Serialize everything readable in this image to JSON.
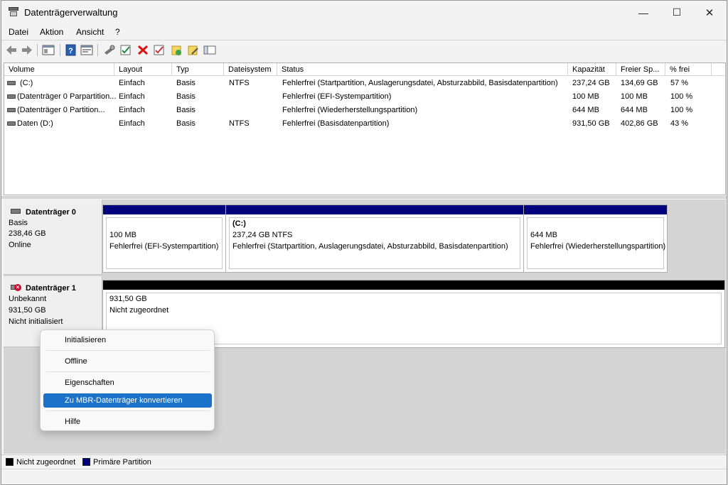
{
  "window": {
    "title": "Datenträgerverwaltung",
    "minimize": "—",
    "maximize": "☐",
    "close": "✕"
  },
  "menu": {
    "file": "Datei",
    "action": "Aktion",
    "view": "Ansicht",
    "help": "?"
  },
  "toolbar": [
    "back-icon",
    "forward-icon",
    "console-icon",
    "help-icon",
    "properties-icon",
    "connect-icon",
    "check-icon",
    "delete-icon",
    "check2-icon",
    "folder-add-icon",
    "folder-open-icon",
    "view-icon"
  ],
  "volumes": {
    "columns": [
      "Volume",
      "Layout",
      "Typ",
      "Dateisystem",
      "Status",
      "Kapazität",
      "Freier Sp...",
      "% frei"
    ],
    "rows": [
      [
        "(C:)",
        "Einfach",
        "Basis",
        "NTFS",
        "Fehlerfrei (Startpartition, Auslagerungsdatei, Absturzabbild, Basisdatenpartition)",
        "237,24 GB",
        "134,69 GB",
        "57 %"
      ],
      [
        "(Datenträger 0 Parpartition...",
        "Einfach",
        "Basis",
        "",
        "Fehlerfrei (EFI-Systempartition)",
        "100 MB",
        "100 MB",
        "100 %"
      ],
      [
        "(Datenträger 0 Partition...",
        "Einfach",
        "Basis",
        "",
        "Fehlerfrei (Wiederherstellungspartition)",
        "644 MB",
        "644 MB",
        "100 %"
      ],
      [
        "Daten (D:)",
        "Einfach",
        "Basis",
        "NTFS",
        "Fehlerfrei (Basisdatenpartition)",
        "931,50 GB",
        "402,86 GB",
        "43 %"
      ]
    ]
  },
  "disks": [
    {
      "name": "Datenträger 0",
      "type": "Basis",
      "size": "238,46 GB",
      "status": "Online",
      "partitions": [
        {
          "title": "",
          "size": "100 MB",
          "status": "Fehlerfrei (EFI-Systempartition)"
        },
        {
          "title": "(C:)",
          "size": "237,24 GB NTFS",
          "status": "Fehlerfrei (Startpartition, Auslagerungsdatei, Absturzabbild, Basisdatenpartition)"
        },
        {
          "title": "",
          "size": "644 MB",
          "status": "Fehlerfrei (Wiederherstellungspartition)"
        }
      ]
    },
    {
      "name": "Datenträger 1",
      "type": "Unbekannt",
      "size": "931,50 GB",
      "status": "Nicht initialisiert",
      "partitions": [
        {
          "title": "",
          "size": "931,50 GB",
          "status": "Nicht zugeordnet"
        }
      ]
    }
  ],
  "context_menu": {
    "items": [
      "Initialisieren",
      "Offline",
      "Eigenschaften",
      "Zu MBR-Datenträger konvertieren",
      "Hilfe"
    ],
    "selected": "Zu MBR-Datenträger konvertieren"
  },
  "legend": [
    {
      "label": "Nicht zugeordnet",
      "color": "#000000"
    },
    {
      "label": "Primäre Partition",
      "color": "#00007f"
    }
  ],
  "colors": {
    "primary_partition": "#00007f",
    "unallocated": "#000000",
    "selection": "#1a73c9"
  }
}
